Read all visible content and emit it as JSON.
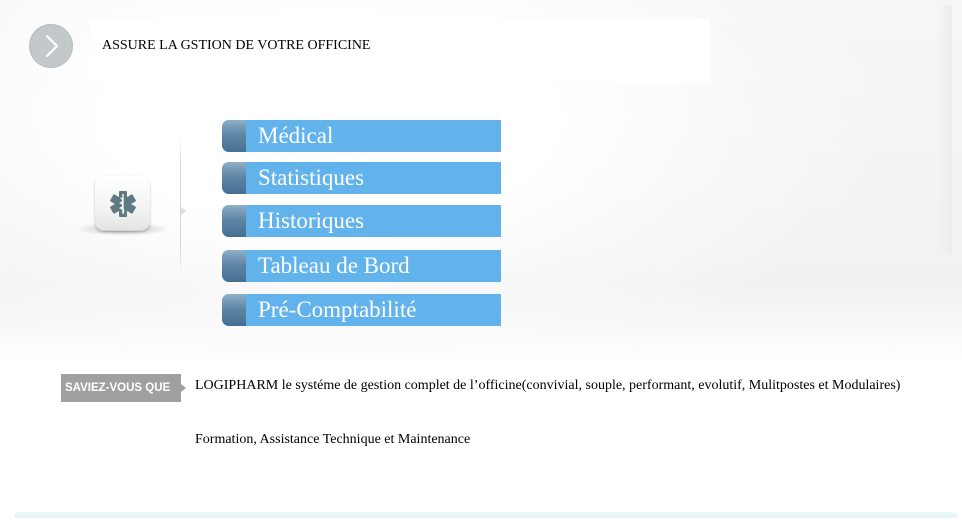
{
  "header": {
    "title": "ASSURE LA GSTION DE VOTRE OFFICINE",
    "nav_icon": "chevron-right-icon"
  },
  "app_icon": {
    "name": "medical-star-of-life-icon",
    "color": "#5f7a82"
  },
  "menu": {
    "items": [
      {
        "label": "Médical"
      },
      {
        "label": "Statistiques"
      },
      {
        "label": "Historiques"
      },
      {
        "label": "Tableau de Bord"
      },
      {
        "label": "Pré-Comptabilité"
      }
    ],
    "color": "#62b3ec",
    "cap_color": "#5a82a3"
  },
  "info": {
    "tag_label": "SAVIEZ-VOUS QUE",
    "tag_color": "#a0a0a0",
    "lines": [
      "LOGIPHARM le systéme de gestion complet de l’officine(convivial, souple, performant, evolutif, Mulitpostes et Modulaires)",
      "Formation,  Assistance Technique et Maintenance"
    ]
  }
}
